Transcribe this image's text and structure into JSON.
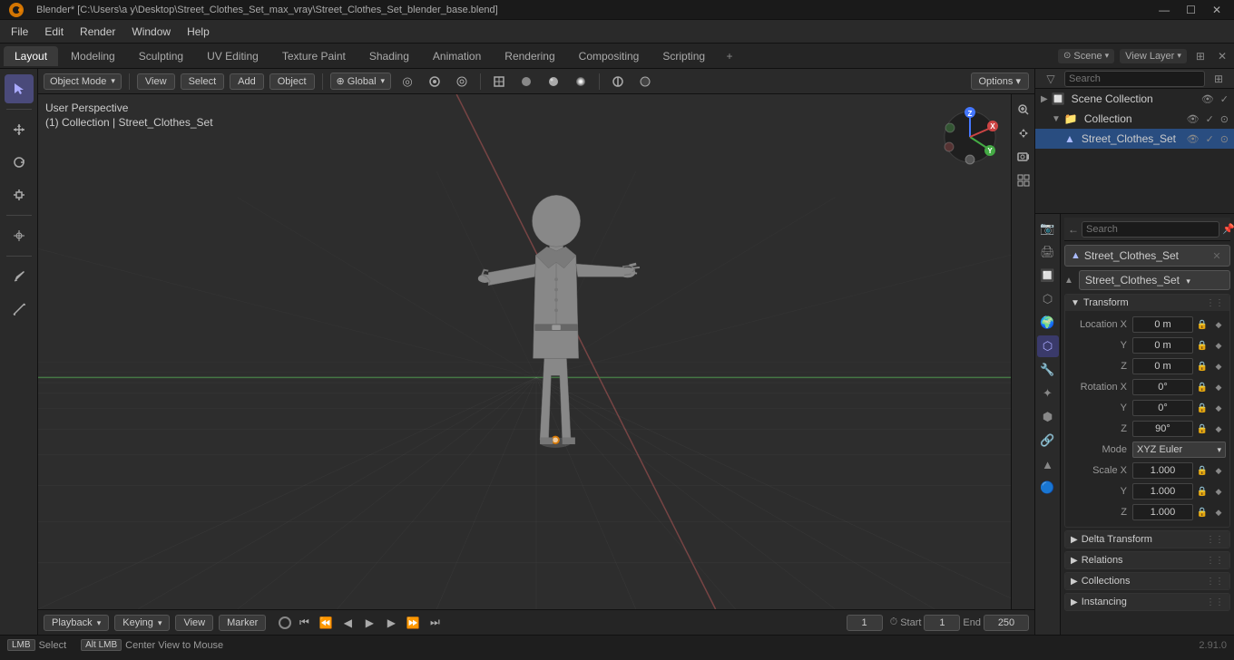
{
  "titlebar": {
    "title": "Blender* [C:\\Users\\a y\\Desktop\\Street_Clothes_Set_max_vray\\Street_Clothes_Set_blender_base.blend]",
    "controls": [
      "—",
      "☐",
      "✕"
    ]
  },
  "menubar": {
    "logo": "⊙",
    "items": [
      "Blender",
      "File",
      "Edit",
      "Render",
      "Window",
      "Help"
    ]
  },
  "workspace_tabs": {
    "tabs": [
      "Layout",
      "Modeling",
      "Sculpting",
      "UV Editing",
      "Texture Paint",
      "Shading",
      "Animation",
      "Rendering",
      "Compositing",
      "Scripting"
    ],
    "active": "Layout",
    "scene": "Scene",
    "view_layer": "View Layer"
  },
  "viewport": {
    "mode": "Object Mode",
    "view_menu": "View",
    "select_menu": "Select",
    "add_menu": "Add",
    "object_menu": "Object",
    "transform": "Global",
    "pivot": "◎",
    "snap": "⊕",
    "overlay": "⊙",
    "viewport_overlay_btn": "⊞",
    "info_line1": "User Perspective",
    "info_line2": "(1) Collection | Street_Clothes_Set",
    "options_btn": "Options ▾"
  },
  "outliner": {
    "scene_collection": "Scene Collection",
    "items": [
      {
        "label": "Collection",
        "depth": 1,
        "has_arrow": true,
        "icon": "📁"
      },
      {
        "label": "Street_Clothes_Set",
        "depth": 2,
        "has_arrow": false,
        "icon": "📦",
        "selected": true
      }
    ]
  },
  "properties": {
    "topbar_search_placeholder": "Search",
    "object_name": "Street_Clothes_Set",
    "object_dropdown": "Street_Clothes_Set",
    "sections": {
      "transform": {
        "label": "Transform",
        "location": {
          "x": "0 m",
          "y": "0 m",
          "z": "0 m"
        },
        "rotation": {
          "x": "0°",
          "y": "0°",
          "z": "90°",
          "mode": "XYZ Euler"
        },
        "scale": {
          "x": "1.000",
          "y": "1.000",
          "z": "1.000"
        }
      },
      "delta_transform": "Delta Transform",
      "relations": "Relations",
      "collections": "Collections",
      "instancing": "Instancing"
    },
    "icons": [
      "🔧",
      "📷",
      "🔲",
      "🎨",
      "⚙",
      "🔗",
      "🔒",
      "📊",
      "🧲",
      "🔵"
    ]
  },
  "timeline": {
    "frame_current": "1",
    "frame_start": "1",
    "frame_end": "250",
    "playback_label": "Playback",
    "keying_label": "Keying",
    "view_label": "View",
    "marker_label": "Marker"
  },
  "statusbar": {
    "select_action": "Select",
    "center_view": "Center View to Mouse",
    "version": "2.91.0"
  }
}
